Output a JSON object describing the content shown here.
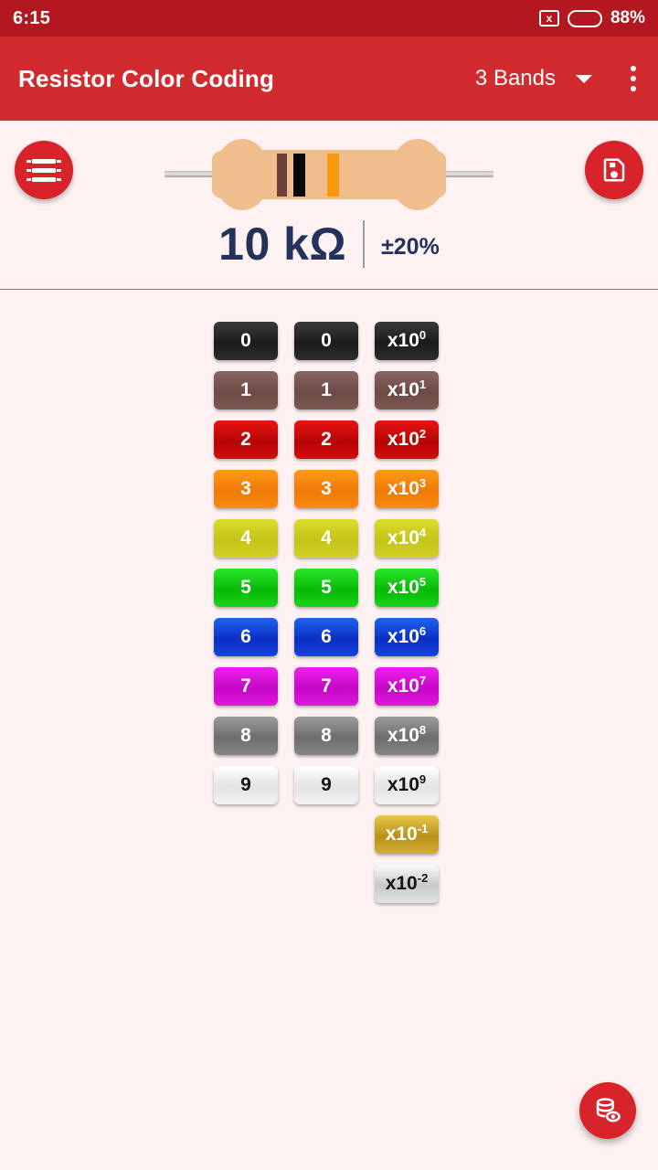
{
  "status_bar": {
    "time": "6:15",
    "close_icon": "x",
    "battery_percent": "88%",
    "battery_level": 80,
    "battery_color": "#f5a623"
  },
  "app_bar": {
    "title": "Resistor Color Coding",
    "band_count_label": "3 Bands",
    "accent_color": "#d12a2f",
    "status_color": "#b3181e"
  },
  "resistor": {
    "body_color": "#efbe8c",
    "bands": [
      {
        "name": "brown",
        "color": "#6d4039"
      },
      {
        "name": "black",
        "color": "#070707"
      },
      {
        "name": "orange",
        "color": "#f8990d"
      }
    ],
    "value": "10 kΩ",
    "tolerance": "±20%",
    "value_color": "#23325a"
  },
  "actions": {
    "bands_fab": "bands-icon",
    "save_fab": "save-icon",
    "database_fab": "database-view-icon"
  },
  "grid": {
    "rows": [
      {
        "digit": "0",
        "exp": "0",
        "color_name": "black",
        "bg": "linear-gradient(#3a3a3a, #1a1a1a 55%, #2e2e2e)",
        "text": "#ffffff"
      },
      {
        "digit": "1",
        "exp": "1",
        "color_name": "brown",
        "bg": "linear-gradient(#8a6660, #6d4a46 55%, #7b5751)",
        "text": "#ffffff"
      },
      {
        "digit": "2",
        "exp": "2",
        "color_name": "red",
        "bg": "linear-gradient(#e81414, #b50505 55%, #d40d0d)",
        "text": "#ffffff"
      },
      {
        "digit": "3",
        "exp": "3",
        "color_name": "orange",
        "bg": "linear-gradient(#ff9a18, #ef7a08 55%, #f98a10)",
        "text": "#ffffff"
      },
      {
        "digit": "4",
        "exp": "4",
        "color_name": "yellow",
        "bg": "linear-gradient(#dede2e, #c3c318 55%, #d2d224)",
        "text": "#ffffff"
      },
      {
        "digit": "5",
        "exp": "5",
        "color_name": "green",
        "bg": "linear-gradient(#2ae82a, #08b808 55%, #17d417)",
        "text": "#ffffff"
      },
      {
        "digit": "6",
        "exp": "6",
        "color_name": "blue",
        "bg": "linear-gradient(#1f63ef, #0b2fc4 55%, #1644dc)",
        "text": "#ffffff"
      },
      {
        "digit": "7",
        "exp": "7",
        "color_name": "violet",
        "bg": "linear-gradient(#f020f0, #c408c4 55%, #e014e0)",
        "text": "#ffffff"
      },
      {
        "digit": "8",
        "exp": "8",
        "color_name": "grey",
        "bg": "linear-gradient(#9b9b9b, #6e6e6e 55%, #858585)",
        "text": "#ffffff"
      },
      {
        "digit": "9",
        "exp": "9",
        "color_name": "white",
        "bg": "linear-gradient(#ffffff, #e4e4e4 55%, #f2f2f2)",
        "text": "#141414"
      },
      {
        "digit": null,
        "exp": "-1",
        "color_name": "gold",
        "bg": "linear-gradient(#e8c64a, #b8901a 55%, #d2ad30)",
        "text": "#ffffff"
      },
      {
        "digit": null,
        "exp": "-2",
        "color_name": "silver",
        "bg": "linear-gradient(#fafafa, #c9c9c9 55%, #e2e2e2)",
        "text": "#141414"
      }
    ],
    "multiplier_prefix": "x10"
  }
}
